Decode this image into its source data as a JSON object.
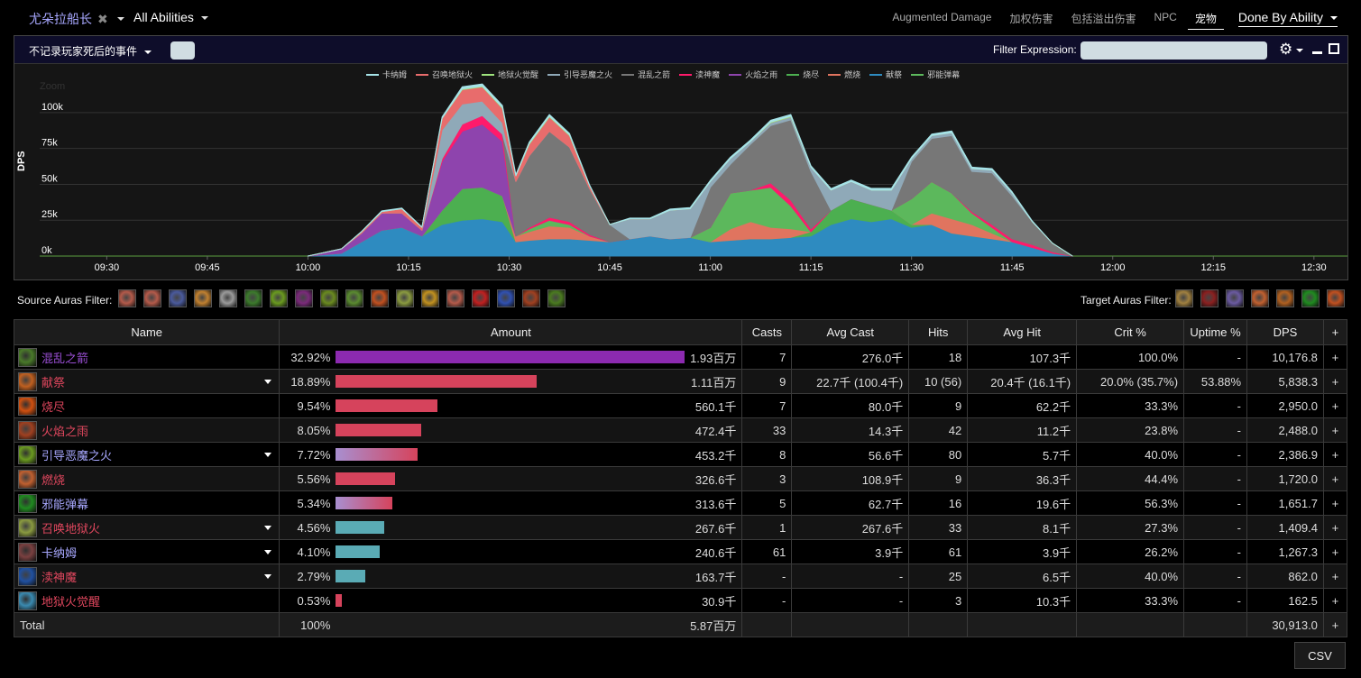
{
  "topbar": {
    "player_name": "尤朵拉船长",
    "abilities_dropdown": "All Abilities",
    "tabs": [
      {
        "label": "Augmented Damage",
        "active": false
      },
      {
        "label": "加权伤害",
        "active": false
      },
      {
        "label": "包括溢出伤害",
        "active": false
      },
      {
        "label": "NPC",
        "active": false
      },
      {
        "label": "宠物",
        "active": true
      }
    ],
    "view_dropdown": "Done By Ability"
  },
  "panel": {
    "death_filter": "不记录玩家死后的事件",
    "filter_label": "Filter Expression:",
    "filter_value": "",
    "zoom_label": "Zoom"
  },
  "chart_data": {
    "type": "area",
    "stacked": true,
    "ylabel": "DPS",
    "xlabel": "",
    "ylim": [
      0,
      110000
    ],
    "yticks": [
      "0k",
      "25k",
      "50k",
      "75k",
      "100k"
    ],
    "ytick_values": [
      0,
      25000,
      50000,
      75000,
      100000
    ],
    "xticks": [
      "09:30",
      "09:45",
      "10:00",
      "10:15",
      "10:30",
      "10:45",
      "11:00",
      "11:15",
      "11:30",
      "11:45",
      "12:00",
      "12:15",
      "12:30"
    ],
    "legend_position": "top-center",
    "x": [
      "10:00",
      "10:05",
      "10:08",
      "10:11",
      "10:14",
      "10:17",
      "10:20",
      "10:23",
      "10:26",
      "10:29",
      "10:31",
      "10:33",
      "10:36",
      "10:39",
      "10:42",
      "10:45",
      "10:48",
      "10:51",
      "10:54",
      "10:57",
      "11:00",
      "11:03",
      "11:06",
      "11:09",
      "11:12",
      "11:15",
      "11:18",
      "11:21",
      "11:24",
      "11:27",
      "11:30",
      "11:33",
      "11:36",
      "11:39",
      "11:42",
      "11:45",
      "11:48",
      "11:51",
      "11:54"
    ],
    "series": [
      {
        "name": "献祭",
        "color": "#2e8bc0",
        "values": [
          0,
          2000,
          10000,
          18000,
          20000,
          14000,
          22000,
          25000,
          26000,
          24000,
          10000,
          11000,
          12000,
          12000,
          11000,
          10000,
          12000,
          14000,
          12000,
          13000,
          10000,
          11000,
          12000,
          12000,
          13000,
          14000,
          22000,
          26000,
          24000,
          26000,
          20000,
          22000,
          16000,
          14000,
          12000,
          10000,
          6000,
          2000,
          0
        ]
      },
      {
        "name": "烧尽",
        "color": "#4caf50",
        "values": [
          0,
          0,
          0,
          0,
          0,
          0,
          10000,
          22000,
          22000,
          18000,
          0,
          0,
          0,
          0,
          0,
          0,
          0,
          0,
          0,
          0,
          0,
          0,
          0,
          0,
          0,
          3000,
          10000,
          14000,
          12000,
          6000,
          2000,
          0,
          0,
          0,
          0,
          0,
          0,
          0,
          0,
          0
        ]
      },
      {
        "name": "燃烧",
        "color": "#e0745f",
        "values": [
          0,
          0,
          0,
          0,
          0,
          0,
          0,
          0,
          0,
          0,
          4000,
          6000,
          9000,
          8000,
          3000,
          0,
          0,
          0,
          0,
          0,
          0,
          8000,
          12000,
          8000,
          6000,
          0,
          0,
          0,
          0,
          0,
          0,
          8000,
          10000,
          8000,
          4000,
          0,
          0,
          0,
          0,
          0
        ]
      },
      {
        "name": "邪能弹幕",
        "color": "#5cb85c",
        "values": [
          0,
          0,
          0,
          0,
          0,
          0,
          0,
          0,
          0,
          0,
          0,
          2000,
          4000,
          2000,
          0,
          0,
          0,
          0,
          0,
          0,
          10000,
          25000,
          22000,
          28000,
          16000,
          0,
          0,
          0,
          0,
          0,
          18000,
          22000,
          18000,
          8000,
          4000,
          0,
          0,
          0,
          0,
          0
        ]
      },
      {
        "name": "火焰之雨",
        "color": "#8e44ad",
        "values": [
          0,
          3000,
          6000,
          12000,
          10000,
          4000,
          34000,
          40000,
          44000,
          38000,
          0,
          0,
          0,
          0,
          0,
          0,
          0,
          0,
          0,
          0,
          0,
          0,
          0,
          0,
          0,
          0,
          0,
          0,
          0,
          0,
          0,
          0,
          0,
          0,
          0,
          0,
          0,
          0,
          0
        ]
      },
      {
        "name": "渎神魔",
        "color": "#ff1a6b",
        "values": [
          0,
          0,
          0,
          0,
          0,
          0,
          2000,
          5000,
          6000,
          5000,
          0,
          1000,
          2000,
          2000,
          1000,
          0,
          0,
          0,
          0,
          0,
          0,
          0,
          0,
          3000,
          4000,
          2000,
          0,
          0,
          0,
          0,
          0,
          0,
          0,
          1000,
          2000,
          2000,
          2000,
          1000,
          0
        ]
      },
      {
        "name": "混乱之箭",
        "color": "#777777",
        "values": [
          0,
          0,
          0,
          0,
          0,
          0,
          0,
          0,
          0,
          0,
          38000,
          50000,
          60000,
          52000,
          32000,
          12000,
          0,
          0,
          0,
          0,
          28000,
          20000,
          32000,
          40000,
          56000,
          40000,
          0,
          0,
          0,
          0,
          26000,
          30000,
          40000,
          28000,
          36000,
          30000,
          16000,
          6000,
          0
        ]
      },
      {
        "name": "引导恶魔之火",
        "color": "#8fa9b8",
        "values": [
          0,
          0,
          0,
          0,
          0,
          0,
          20000,
          14000,
          10000,
          8000,
          0,
          0,
          0,
          0,
          0,
          0,
          14000,
          12000,
          20000,
          20000,
          4000,
          4000,
          2000,
          2000,
          2000,
          3000,
          14000,
          12000,
          10000,
          14000,
          2000,
          2000,
          2000,
          2000,
          2000,
          2000,
          0,
          0,
          0
        ]
      },
      {
        "name": "召唤地狱火",
        "color": "#e86c6c",
        "values": [
          0,
          0,
          1000,
          1000,
          3000,
          2000,
          8000,
          10000,
          10000,
          10000,
          4000,
          8000,
          10000,
          8000,
          2000,
          0,
          0,
          0,
          0,
          0,
          0,
          0,
          0,
          0,
          0,
          0,
          0,
          0,
          0,
          0,
          0,
          0,
          0,
          0,
          0,
          0,
          0,
          0,
          0
        ]
      },
      {
        "name": "地狱火觉醒",
        "color": "#9ee37d",
        "values": [
          0,
          0,
          0,
          0,
          0,
          0,
          0,
          500,
          500,
          500,
          0,
          500,
          500,
          500,
          0,
          0,
          0,
          0,
          0,
          0,
          0,
          0,
          0,
          500,
          500,
          0,
          0,
          0,
          0,
          0,
          0,
          0,
          0,
          0,
          0,
          0,
          0,
          0,
          0
        ]
      },
      {
        "name": "卡纳姆",
        "color": "#a6e3e8",
        "values": [
          0,
          0,
          200,
          500,
          500,
          300,
          1000,
          1500,
          1500,
          1500,
          800,
          1000,
          1200,
          1000,
          500,
          0,
          500,
          500,
          800,
          800,
          800,
          1000,
          1000,
          1200,
          1200,
          1000,
          1000,
          1000,
          1200,
          1200,
          1000,
          1000,
          1200,
          1000,
          1000,
          800,
          500,
          0,
          0
        ]
      }
    ],
    "legend": [
      "卡纳姆",
      "召唤地狱火",
      "地狱火觉醒",
      "引导恶魔之火",
      "混乱之箭",
      "渎神魔",
      "火焰之雨",
      "烧尽",
      "燃烧",
      "献祭",
      "邪能弹幕"
    ],
    "legend_colors": [
      "#a6e3e8",
      "#e86c6c",
      "#9ee37d",
      "#8fa9b8",
      "#777777",
      "#ff1a6b",
      "#8e44ad",
      "#4caf50",
      "#e0745f",
      "#2e8bc0",
      "#5cb85c"
    ]
  },
  "auras": {
    "source_label": "Source Auras Filter:",
    "source_icons": [
      {
        "name": "aura-icon-1",
        "color": "#b35a4a"
      },
      {
        "name": "aura-icon-2",
        "color": "#b35a4a"
      },
      {
        "name": "aura-icon-3",
        "color": "#4a5a9c"
      },
      {
        "name": "aura-icon-4",
        "color": "#c08030"
      },
      {
        "name": "aura-icon-5",
        "color": "#9a9a9a"
      },
      {
        "name": "aura-icon-6",
        "color": "#3c7a2c"
      },
      {
        "name": "aura-icon-7",
        "color": "#6a9a20"
      },
      {
        "name": "aura-icon-8",
        "color": "#7a2a7a"
      },
      {
        "name": "aura-icon-9",
        "color": "#6a8a20"
      },
      {
        "name": "aura-icon-10",
        "color": "#5a8a30"
      },
      {
        "name": "aura-icon-11",
        "color": "#c05020"
      },
      {
        "name": "aura-icon-12",
        "color": "#8a9a40"
      },
      {
        "name": "aura-icon-13",
        "color": "#c09020"
      },
      {
        "name": "aura-icon-14",
        "color": "#b35a4a"
      },
      {
        "name": "aura-icon-15",
        "color": "#c02020"
      },
      {
        "name": "aura-icon-16",
        "color": "#3050b0"
      },
      {
        "name": "aura-icon-17",
        "color": "#a04020"
      },
      {
        "name": "aura-icon-18",
        "color": "#4a7a20"
      }
    ],
    "target_label": "Target Auras Filter:",
    "target_icons": [
      {
        "name": "target-aura-icon-1",
        "color": "#a08040"
      },
      {
        "name": "target-aura-icon-2",
        "color": "#8a2020"
      },
      {
        "name": "target-aura-icon-3",
        "color": "#6a5aa0"
      },
      {
        "name": "target-aura-icon-4",
        "color": "#c06030"
      },
      {
        "name": "target-aura-icon-5",
        "color": "#b06020"
      },
      {
        "name": "target-aura-icon-6",
        "color": "#208a20"
      },
      {
        "name": "target-aura-icon-7",
        "color": "#c05020"
      }
    ]
  },
  "table": {
    "headers": [
      "Name",
      "Amount",
      "Casts",
      "Avg Cast",
      "Hits",
      "Avg Hit",
      "Crit %",
      "Uptime %",
      "DPS",
      "+"
    ],
    "rows": [
      {
        "name": "混乱之箭",
        "name_color": "#9b4fd6",
        "icon_color": "#4a7a2a",
        "expandable": false,
        "pct": "32.92%",
        "bar_fraction": 1.0,
        "bar_style": "#8c2ab0",
        "amount": "1.93百万",
        "casts": "7",
        "avg_cast": "276.0千",
        "hits": "18",
        "avg_hit": "107.3千",
        "crit": "100.0%",
        "uptime": "-",
        "dps": "10,176.8"
      },
      {
        "name": "献祭",
        "name_color": "#e0475e",
        "icon_color": "#c06020",
        "expandable": true,
        "pct": "18.89%",
        "bar_fraction": 0.574,
        "bar_style": "#d6435c",
        "amount": "1.11百万",
        "casts": "9",
        "avg_cast": "22.7千 (100.4千)",
        "hits": "10 (56)",
        "avg_hit": "20.4千 (16.1千)",
        "crit": "20.0% (35.7%)",
        "uptime": "53.88%",
        "dps": "5,838.3"
      },
      {
        "name": "烧尽",
        "name_color": "#e0475e",
        "icon_color": "#d05010",
        "expandable": false,
        "pct": "9.54%",
        "bar_fraction": 0.29,
        "bar_style": "#d6435c",
        "amount": "560.1千",
        "casts": "7",
        "avg_cast": "80.0千",
        "hits": "9",
        "avg_hit": "62.2千",
        "crit": "33.3%",
        "uptime": "-",
        "dps": "2,950.0"
      },
      {
        "name": "火焰之雨",
        "name_color": "#e0475e",
        "icon_color": "#a04020",
        "expandable": false,
        "pct": "8.05%",
        "bar_fraction": 0.245,
        "bar_style": "#d6435c",
        "amount": "472.4千",
        "casts": "33",
        "avg_cast": "14.3千",
        "hits": "42",
        "avg_hit": "11.2千",
        "crit": "23.8%",
        "uptime": "-",
        "dps": "2,488.0"
      },
      {
        "name": "引导恶魔之火",
        "name_color": "#a8a8ff",
        "icon_color": "#6a9a20",
        "expandable": true,
        "pct": "7.72%",
        "bar_fraction": 0.235,
        "bar_style": "linear-gradient(90deg,#a88fd0,#d6435c)",
        "amount": "453.2千",
        "casts": "8",
        "avg_cast": "56.6千",
        "hits": "80",
        "avg_hit": "5.7千",
        "crit": "40.0%",
        "uptime": "-",
        "dps": "2,386.9"
      },
      {
        "name": "燃烧",
        "name_color": "#e0475e",
        "icon_color": "#c06030",
        "expandable": false,
        "pct": "5.56%",
        "bar_fraction": 0.169,
        "bar_style": "#d6435c",
        "amount": "326.6千",
        "casts": "3",
        "avg_cast": "108.9千",
        "hits": "9",
        "avg_hit": "36.3千",
        "crit": "44.4%",
        "uptime": "-",
        "dps": "1,720.0"
      },
      {
        "name": "邪能弹幕",
        "name_color": "#a8a8ff",
        "icon_color": "#208a20",
        "expandable": false,
        "pct": "5.34%",
        "bar_fraction": 0.162,
        "bar_style": "linear-gradient(90deg,#a88fd0,#d6435c)",
        "amount": "313.6千",
        "casts": "5",
        "avg_cast": "62.7千",
        "hits": "16",
        "avg_hit": "19.6千",
        "crit": "56.3%",
        "uptime": "-",
        "dps": "1,651.7"
      },
      {
        "name": "召唤地狱火",
        "name_color": "#e0475e",
        "icon_color": "#8a9a40",
        "expandable": true,
        "pct": "4.56%",
        "bar_fraction": 0.139,
        "bar_style": "#5aabb5",
        "amount": "267.6千",
        "casts": "1",
        "avg_cast": "267.6千",
        "hits": "33",
        "avg_hit": "8.1千",
        "crit": "27.3%",
        "uptime": "-",
        "dps": "1,409.4"
      },
      {
        "name": "卡纳姆",
        "name_color": "#a8a8ff",
        "icon_color": "#7a4040",
        "expandable": true,
        "pct": "4.10%",
        "bar_fraction": 0.125,
        "bar_style": "#5aabb5",
        "amount": "240.6千",
        "casts": "61",
        "avg_cast": "3.9千",
        "hits": "61",
        "avg_hit": "3.9千",
        "crit": "26.2%",
        "uptime": "-",
        "dps": "1,267.3"
      },
      {
        "name": "渎神魔",
        "name_color": "#e0475e",
        "icon_color": "#2050a0",
        "expandable": true,
        "pct": "2.79%",
        "bar_fraction": 0.085,
        "bar_style": "#5aabb5",
        "amount": "163.7千",
        "casts": "-",
        "avg_cast": "-",
        "hits": "25",
        "avg_hit": "6.5千",
        "crit": "40.0%",
        "uptime": "-",
        "dps": "862.0"
      },
      {
        "name": "地狱火觉醒",
        "name_color": "#e0475e",
        "icon_color": "#3a8ab0",
        "expandable": false,
        "pct": "0.53%",
        "bar_fraction": 0.016,
        "bar_style": "#d6435c",
        "amount": "30.9千",
        "casts": "-",
        "avg_cast": "-",
        "hits": "3",
        "avg_hit": "10.3千",
        "crit": "33.3%",
        "uptime": "-",
        "dps": "162.5"
      }
    ],
    "total": {
      "label": "Total",
      "pct": "100%",
      "amount": "5.87百万",
      "dps": "30,913.0"
    }
  },
  "csv_label": "CSV"
}
